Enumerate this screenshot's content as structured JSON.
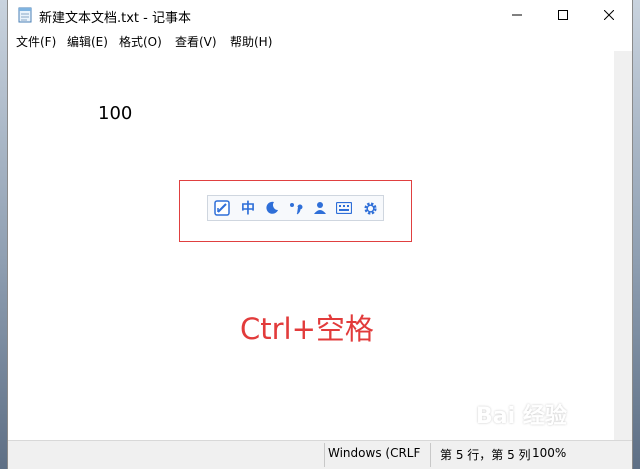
{
  "window": {
    "title": "新建文本文档.txt - 记事本"
  },
  "menu": {
    "items": [
      "文件(F)",
      "编辑(E)",
      "格式(O)",
      "查看(V)",
      "帮助(H)"
    ]
  },
  "editor": {
    "content": "100"
  },
  "ime_toolbar": {
    "mode_label": "中",
    "icons": [
      "ime-logo-icon",
      "chinese-mode-label",
      "moon-icon",
      "punctuation-icon",
      "user-icon",
      "keyboard-icon",
      "gear-icon"
    ],
    "accent_color": "#2f6fd8"
  },
  "annotation": {
    "text": "Ctrl+空格",
    "color": "#e23b3b"
  },
  "statusbar": {
    "encoding": "Windows (CRLF",
    "position": "第 5 行，第 5 列",
    "zoom": "100%"
  },
  "watermark": {
    "text": "Bai 经验"
  }
}
